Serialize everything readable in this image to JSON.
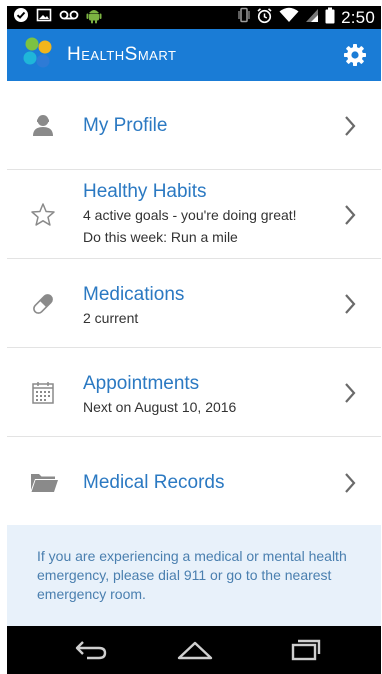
{
  "status_bar": {
    "time": "2:50",
    "left_icons": [
      "check-circle-icon",
      "image-icon",
      "voicemail-icon",
      "android-icon"
    ],
    "right_icons": [
      "vibrate-icon",
      "alarm-icon",
      "wifi-icon",
      "signal-icon",
      "battery-icon"
    ]
  },
  "header": {
    "app_name": "HealthSmart",
    "logo_colors": [
      "#2e7bd6",
      "#f1b51c",
      "#7cc242",
      "#1fb6d9"
    ],
    "settings_icon": "gear-icon",
    "background_color": "#1a7cd6"
  },
  "menu": {
    "items": [
      {
        "title": "My Profile",
        "icon": "person-icon"
      },
      {
        "title": "Healthy Habits",
        "icon": "star-icon",
        "subtitle": "4 active goals - you're doing great!",
        "subtitle2": "Do this week: Run a mile"
      },
      {
        "title": "Medications",
        "icon": "pill-icon",
        "subtitle": "2 current"
      },
      {
        "title": "Appointments",
        "icon": "calendar-icon",
        "subtitle": "Next on August 10, 2016"
      },
      {
        "title": "Medical Records",
        "icon": "folder-icon"
      }
    ],
    "title_color": "#2b79c2"
  },
  "emergency": {
    "text": "If you are experiencing a medical or mental health emergency, please dial 911 or go to the nearest emergency room."
  },
  "nav_bar": {
    "icons": [
      "back-icon",
      "home-icon",
      "recent-apps-icon"
    ]
  }
}
